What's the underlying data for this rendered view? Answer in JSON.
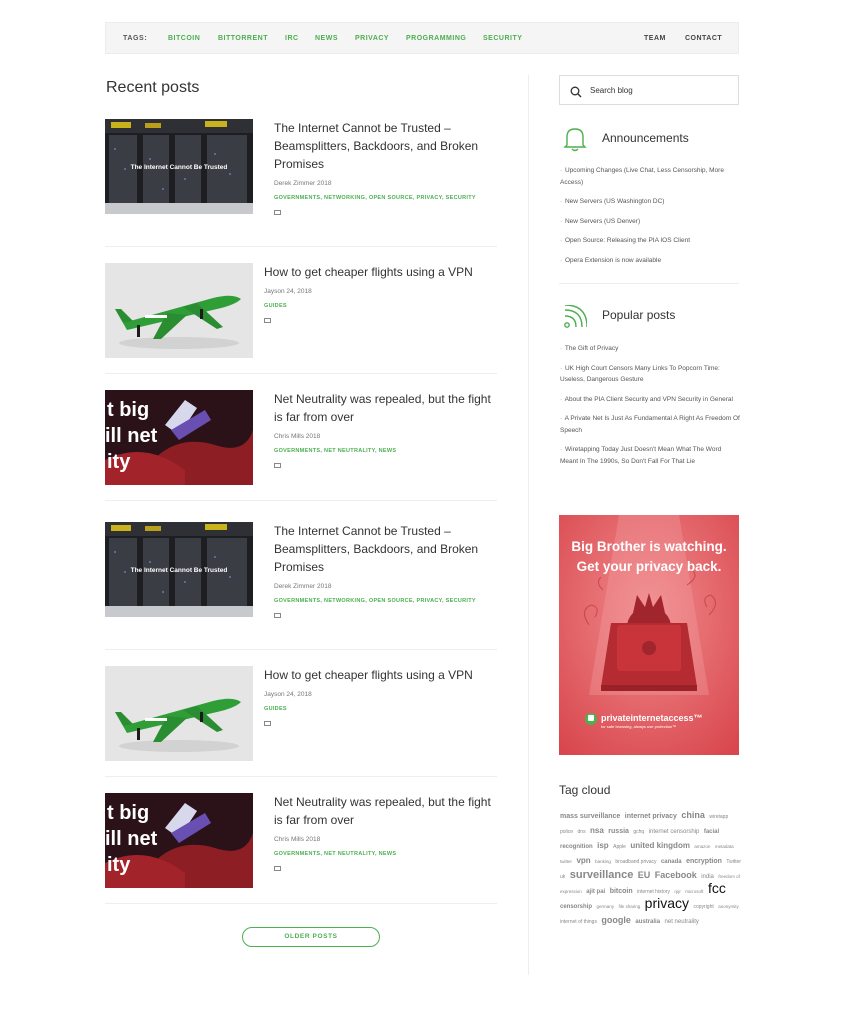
{
  "tagbar": {
    "label": "TAGS:",
    "tags": [
      "BITCOIN",
      "BITTORRENT",
      "IRC",
      "NEWS",
      "PRIVACY",
      "PROGRAMMING",
      "SECURITY"
    ],
    "team": "TEAM",
    "contact": "CONTACT"
  },
  "recent_title": "Recent posts",
  "posts": [
    {
      "title": "The Internet Cannot be Trusted – Beamsplitters, Backdoors, and Broken Promises",
      "meta": "Derek Zimmer 2018",
      "cats": "GOVERNMENTS, NETWORKING, OPEN SOURCE, PRIVACY, SECURITY",
      "thumb_text": "The Internet Cannot Be Trusted"
    },
    {
      "title": "How to get cheaper flights using a VPN",
      "meta": "Jayson 24, 2018",
      "cats": "GUIDES"
    },
    {
      "title": "Net Neutrality was repealed, but the fight is far from over",
      "meta": "Chris Mills 2018",
      "cats": "GOVERNMENTS, NET NEUTRALITY, NEWS",
      "thumb_text": [
        "t big",
        "ill net",
        "ity"
      ]
    },
    {
      "title": "The Internet Cannot be Trusted – Beamsplitters, Backdoors, and Broken Promises",
      "meta": "Derek Zimmer 2018",
      "cats": "GOVERNMENTS, NETWORKING, OPEN SOURCE, PRIVACY, SECURITY",
      "thumb_text": "The Internet Cannot Be Trusted"
    },
    {
      "title": "How to get cheaper flights using a VPN",
      "meta": "Jayson 24, 2018",
      "cats": "GUIDES"
    },
    {
      "title": "Net Neutrality was repealed, but the fight is far from over",
      "meta": "Chris Mills 2018",
      "cats": "GOVERNMENTS, NET NEUTRALITY, NEWS",
      "thumb_text": [
        "t big",
        "ill net",
        "ity"
      ]
    }
  ],
  "older_posts": "OLDER POSTS",
  "search": {
    "placeholder": "Search blog"
  },
  "announcements": {
    "title": "Announcements",
    "items": [
      "Upcoming Changes (Live Chat, Less Censorship, More Access)",
      "New Servers (US Washington DC)",
      "New Servers (US Denver)",
      "Open Source: Releasing the PIA IOS Client",
      "Opera Extension is now available"
    ]
  },
  "popular": {
    "title": "Popular posts",
    "items": [
      "The Gift of Privacy",
      "UK High Court Censors Many Links To Popcorn Time: Useless, Dangerous Gesture",
      "About the PIA Client Security and VPN Security in General",
      "A Private Net Is Just As Fundamental A Right As Freedom Of Speech",
      "Wiretapping Today Just Doesn't Mean What The Word Meant In The 1990s, So Don't Fall For That Lie"
    ]
  },
  "ad": {
    "headline1": "Big Brother is watching.",
    "headline2": "Get your privacy back.",
    "brand": "privateinternetaccess™",
    "tagline": "for safe browsing, always use protection™"
  },
  "tagcloud": {
    "title": "Tag cloud",
    "tags": [
      {
        "t": "mass surveillance",
        "s": 7,
        "b": 1
      },
      {
        "t": "internet privacy",
        "s": 7,
        "b": 1
      },
      {
        "t": "china",
        "s": 9,
        "b": 1
      },
      {
        "t": "wiretapp",
        "s": 5
      },
      {
        "t": "police",
        "s": 5
      },
      {
        "t": "dns",
        "s": 5
      },
      {
        "t": "nsa",
        "s": 8,
        "b": 1
      },
      {
        "t": "russia",
        "s": 7,
        "b": 1
      },
      {
        "t": "gchq",
        "s": 5
      },
      {
        "t": "internet censorship",
        "s": 6
      },
      {
        "t": "facial recognition",
        "s": 6,
        "b": 1
      },
      {
        "t": "isp",
        "s": 8,
        "b": 1
      },
      {
        "t": "Apple",
        "s": 5
      },
      {
        "t": "united kingdom",
        "s": 8,
        "b": 1
      },
      {
        "t": "amazon",
        "s": 4.5
      },
      {
        "t": "metadata",
        "s": 4.5
      },
      {
        "t": "twitter",
        "s": 4.5
      },
      {
        "t": "vpn",
        "s": 8,
        "b": 1
      },
      {
        "t": "banking",
        "s": 4.5
      },
      {
        "t": "broadband privacy",
        "s": 5
      },
      {
        "t": "canada",
        "s": 6,
        "b": 1
      },
      {
        "t": "encryption",
        "s": 7,
        "b": 1
      },
      {
        "t": "Twitter",
        "s": 5
      },
      {
        "t": "uk",
        "s": 5
      },
      {
        "t": "surveillance",
        "s": 11,
        "b": 1
      },
      {
        "t": "EU",
        "s": 9,
        "b": 1
      },
      {
        "t": "Facebook",
        "s": 9,
        "b": 1
      },
      {
        "t": "india",
        "s": 6
      },
      {
        "t": "freedom of expression",
        "s": 4.5
      },
      {
        "t": "ajit pai",
        "s": 6,
        "b": 1
      },
      {
        "t": "bitcoin",
        "s": 7,
        "b": 1
      },
      {
        "t": "internet history",
        "s": 5
      },
      {
        "t": "rpjr",
        "s": 4.5
      },
      {
        "t": "microsoft",
        "s": 4.5
      },
      {
        "t": "fcc",
        "s": 14,
        "b": 2
      },
      {
        "t": "censorship",
        "s": 6,
        "b": 1
      },
      {
        "t": "germany",
        "s": 4.5
      },
      {
        "t": "file sharing",
        "s": 4.5
      },
      {
        "t": "privacy",
        "s": 14,
        "b": 2
      },
      {
        "t": "copyright",
        "s": 5
      },
      {
        "t": "anonymity",
        "s": 4.5
      },
      {
        "t": "internet of things",
        "s": 5
      },
      {
        "t": "google",
        "s": 9,
        "b": 1
      },
      {
        "t": "australia",
        "s": 6,
        "b": 1
      },
      {
        "t": "net neutrality",
        "s": 6
      }
    ]
  },
  "colors": {
    "accent": "#4caf50",
    "ad_bg": "#e05a5e"
  }
}
